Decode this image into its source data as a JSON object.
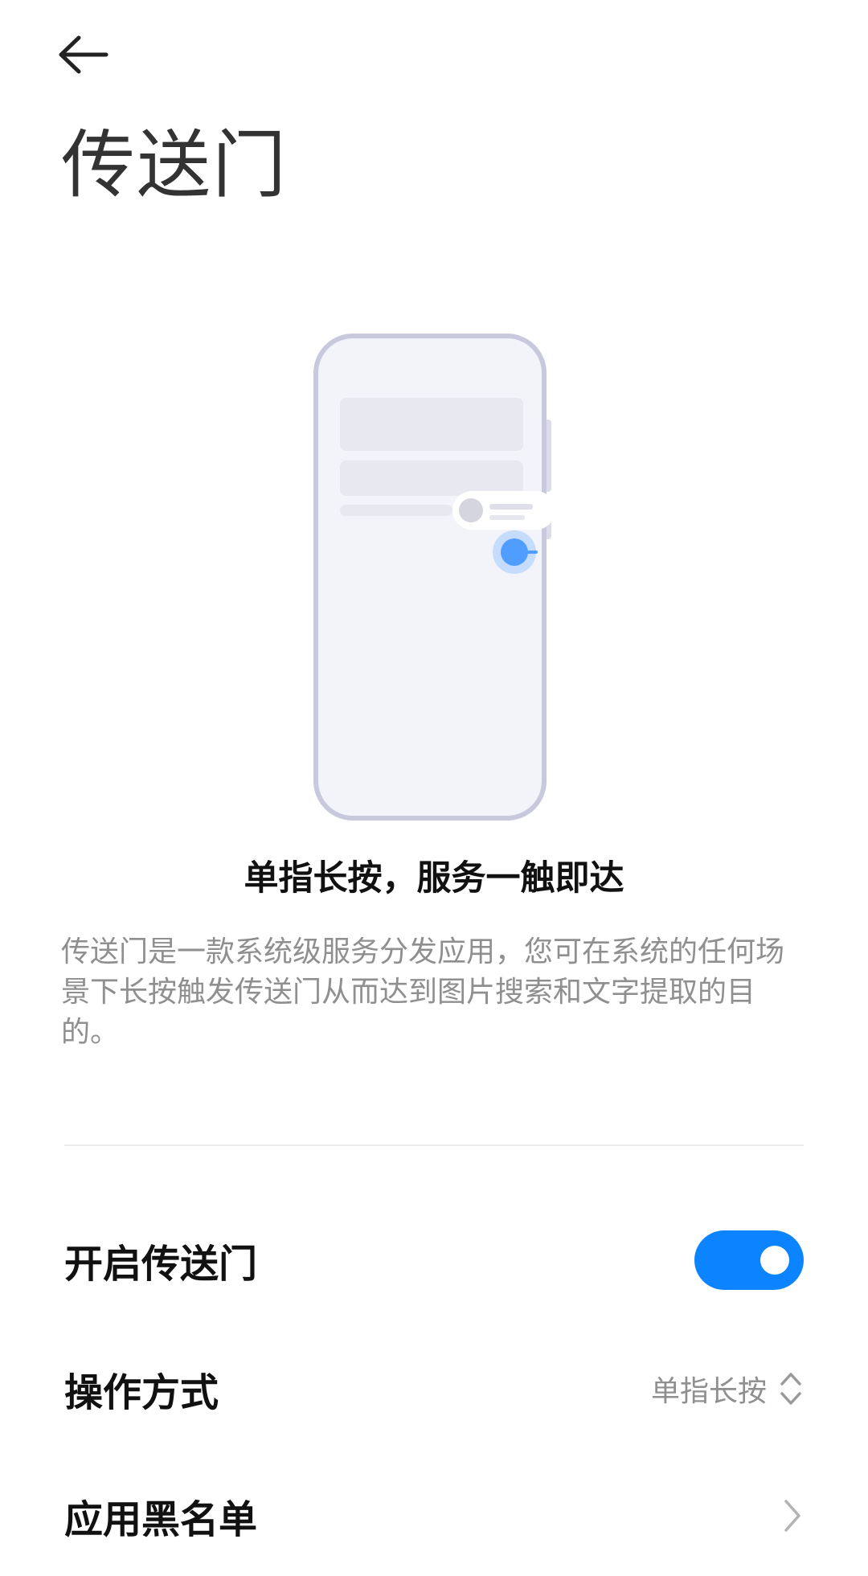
{
  "header": {
    "back_icon": "arrow-left-icon",
    "title": "传送门"
  },
  "intro": {
    "headline": "单指长按，服务一触即达",
    "description": "传送门是一款系统级服务分发应用，您可在系统的任何场景下长按触发传送门从而达到图片搜索和文字提取的目的。"
  },
  "settings": {
    "enable": {
      "label": "开启传送门",
      "enabled": true
    },
    "operation_mode": {
      "label": "操作方式",
      "value": "单指长按",
      "icon": "up-down-chevron-icon"
    },
    "blacklist": {
      "label": "应用黑名单",
      "icon": "chevron-right-icon"
    }
  },
  "colors": {
    "accent": "#0d84ff",
    "secondary_text": "#8f8f8f",
    "phone_outline": "#c9c9dd"
  }
}
